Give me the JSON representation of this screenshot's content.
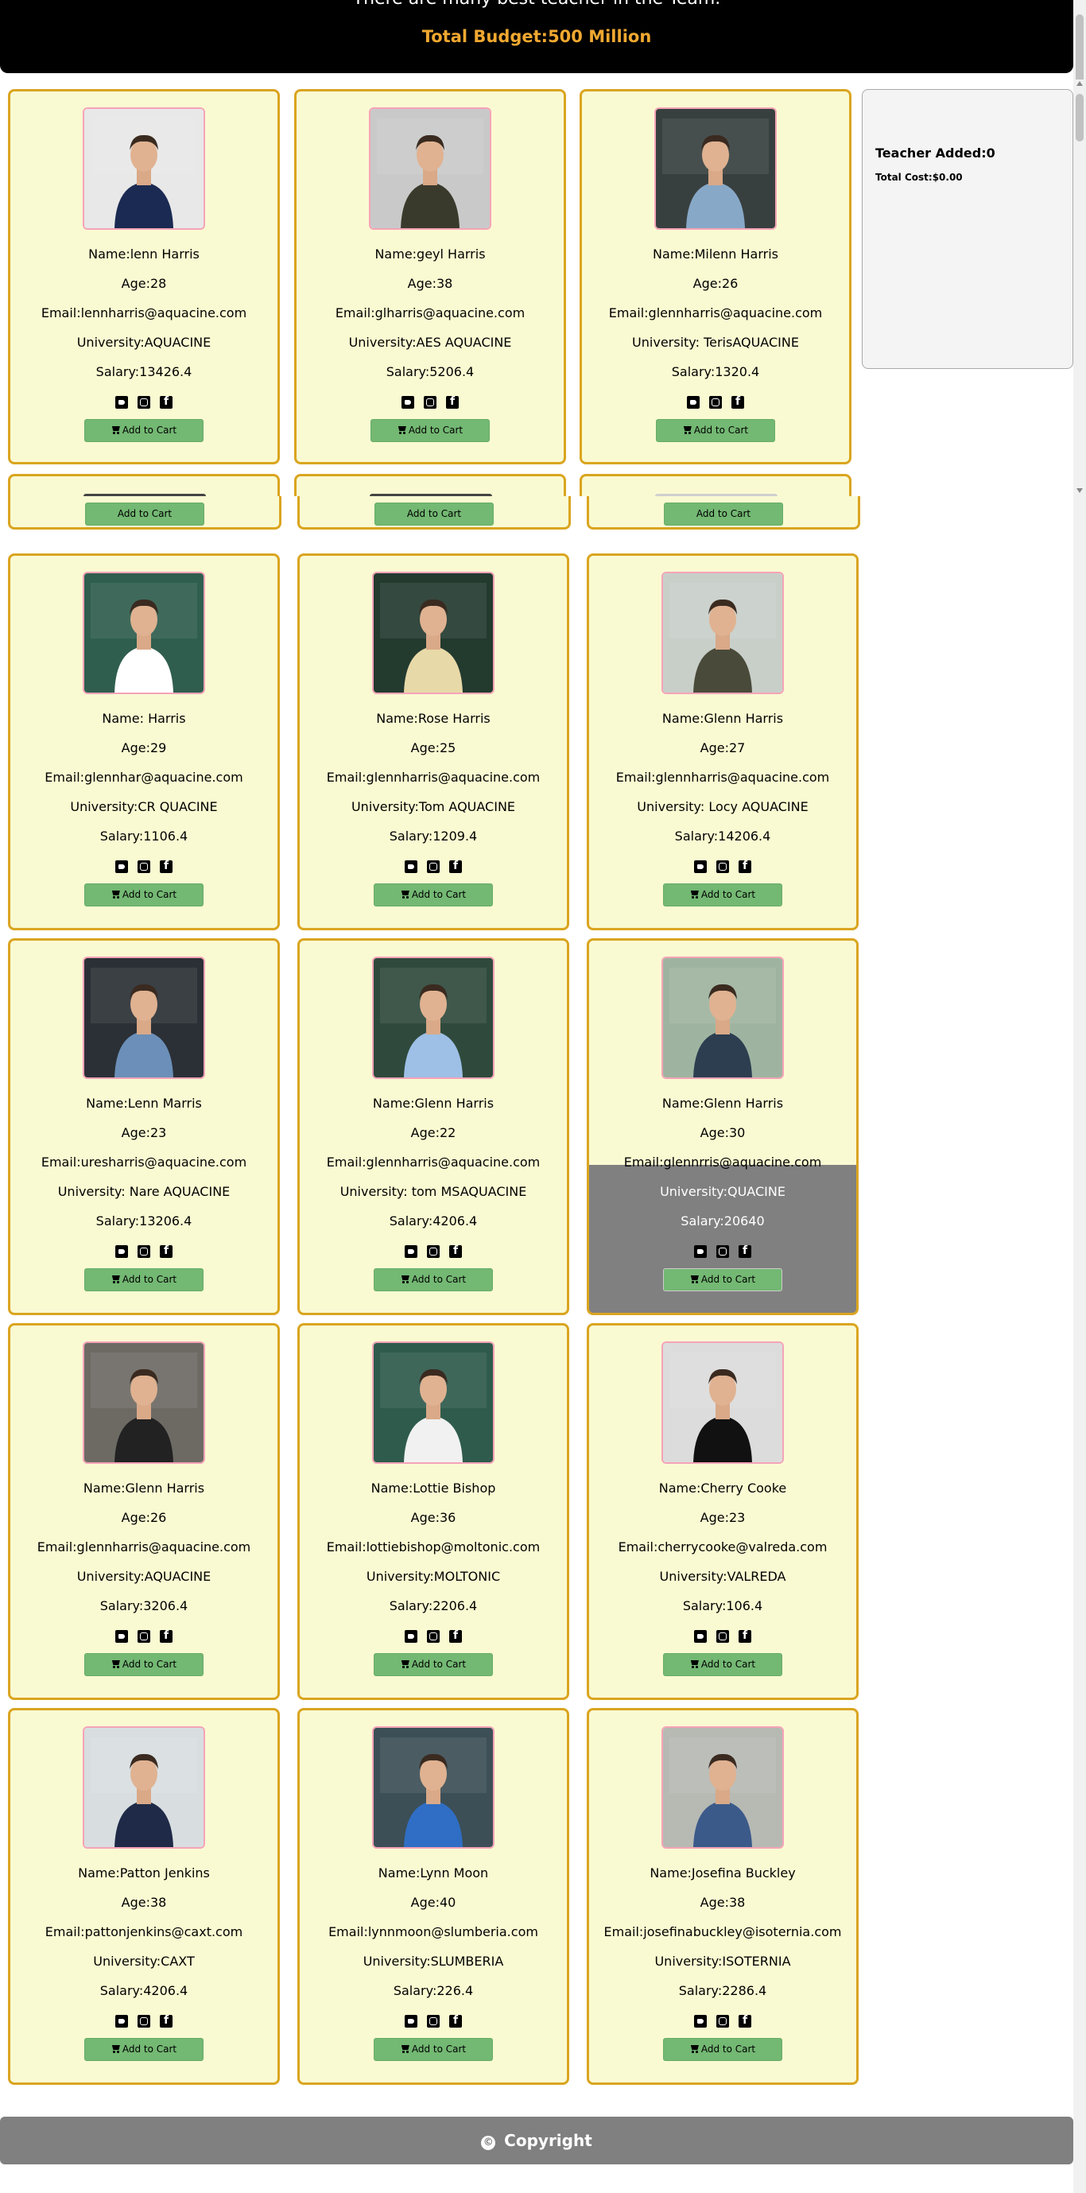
{
  "header": {
    "tagline": "There are many best teacher in the Team.",
    "budget": "Total Budget:500 Million"
  },
  "cart": {
    "added": "Teacher Added:0",
    "total": "Total Cost:$0.00"
  },
  "add_label": "Add to Cart",
  "footer": {
    "text": "Copyright",
    "icon": "©"
  },
  "icons": [
    "twitter-icon",
    "instagram-icon",
    "facebook-icon",
    "cart-icon",
    "copyright-icon"
  ],
  "colors": {
    "card_bg": "#fafad2",
    "card_border": "#daa520",
    "button": "#73b873",
    "budget": "#f0a830",
    "footer": "#808080",
    "hover": "#808080"
  },
  "top_teachers": [
    {
      "name": "Name:lenn Harris",
      "age": "Age:28",
      "email": "Email:lennharris@aquacine.com",
      "university": "University:AQUACINE",
      "salary": "Salary:13426.4"
    },
    {
      "name": "Name:geyl Harris",
      "age": "Age:38",
      "email": "Email:glharris@aquacine.com",
      "university": "University:AES AQUACINE",
      "salary": "Salary:5206.4"
    },
    {
      "name": "Name:Milenn Harris",
      "age": "Age:26",
      "email": "Email:glennharris@aquacine.com",
      "university": "University: TerisAQUACINE",
      "salary": "Salary:1320.4"
    }
  ],
  "teachers": [
    {
      "name": "Name: Harris",
      "age": "Age:29",
      "email": "Email:glennhar@aquacine.com",
      "university": "University:CR QUACINE",
      "salary": "Salary:1106.4"
    },
    {
      "name": "Name:Rose Harris",
      "age": "Age:25",
      "email": "Email:glennharris@aquacine.com",
      "university": "University:Tom AQUACINE",
      "salary": "Salary:1209.4"
    },
    {
      "name": "Name:Glenn Harris",
      "age": "Age:27",
      "email": "Email:glennharris@aquacine.com",
      "university": "University: Locy AQUACINE",
      "salary": "Salary:14206.4"
    },
    {
      "name": "Name:Lenn Marris",
      "age": "Age:23",
      "email": "Email:uresharris@aquacine.com",
      "university": "University: Nare AQUACINE",
      "salary": "Salary:13206.4"
    },
    {
      "name": "Name:Glenn Harris",
      "age": "Age:22",
      "email": "Email:glennharris@aquacine.com",
      "university": "University: tom MSAQUACINE",
      "salary": "Salary:4206.4"
    },
    {
      "name": "Name:Glenn Harris",
      "age": "Age:30",
      "email": "Email:glennrris@aquacine.com",
      "university": "University:QUACINE",
      "salary": "Salary:20640"
    },
    {
      "name": "Name:Glenn Harris",
      "age": "Age:26",
      "email": "Email:glennharris@aquacine.com",
      "university": "University:AQUACINE",
      "salary": "Salary:3206.4"
    },
    {
      "name": "Name:Lottie Bishop",
      "age": "Age:36",
      "email": "Email:lottiebishop@moltonic.com",
      "university": "University:MOLTONIC",
      "salary": "Salary:2206.4"
    },
    {
      "name": "Name:Cherry Cooke",
      "age": "Age:23",
      "email": "Email:cherrycooke@valreda.com",
      "university": "University:VALREDA",
      "salary": "Salary:106.4"
    },
    {
      "name": "Name:Patton Jenkins",
      "age": "Age:38",
      "email": "Email:pattonjenkins@caxt.com",
      "university": "University:CAXT",
      "salary": "Salary:4206.4"
    },
    {
      "name": "Name:Lynn Moon",
      "age": "Age:40",
      "email": "Email:lynnmoon@slumberia.com",
      "university": "University:SLUMBERIA",
      "salary": "Salary:226.4"
    },
    {
      "name": "Name:Josefina Buckley",
      "age": "Age:38",
      "email": "Email:josefinabuckley@isoternia.com",
      "university": "University:ISOTERNIA",
      "salary": "Salary:2286.4"
    }
  ]
}
